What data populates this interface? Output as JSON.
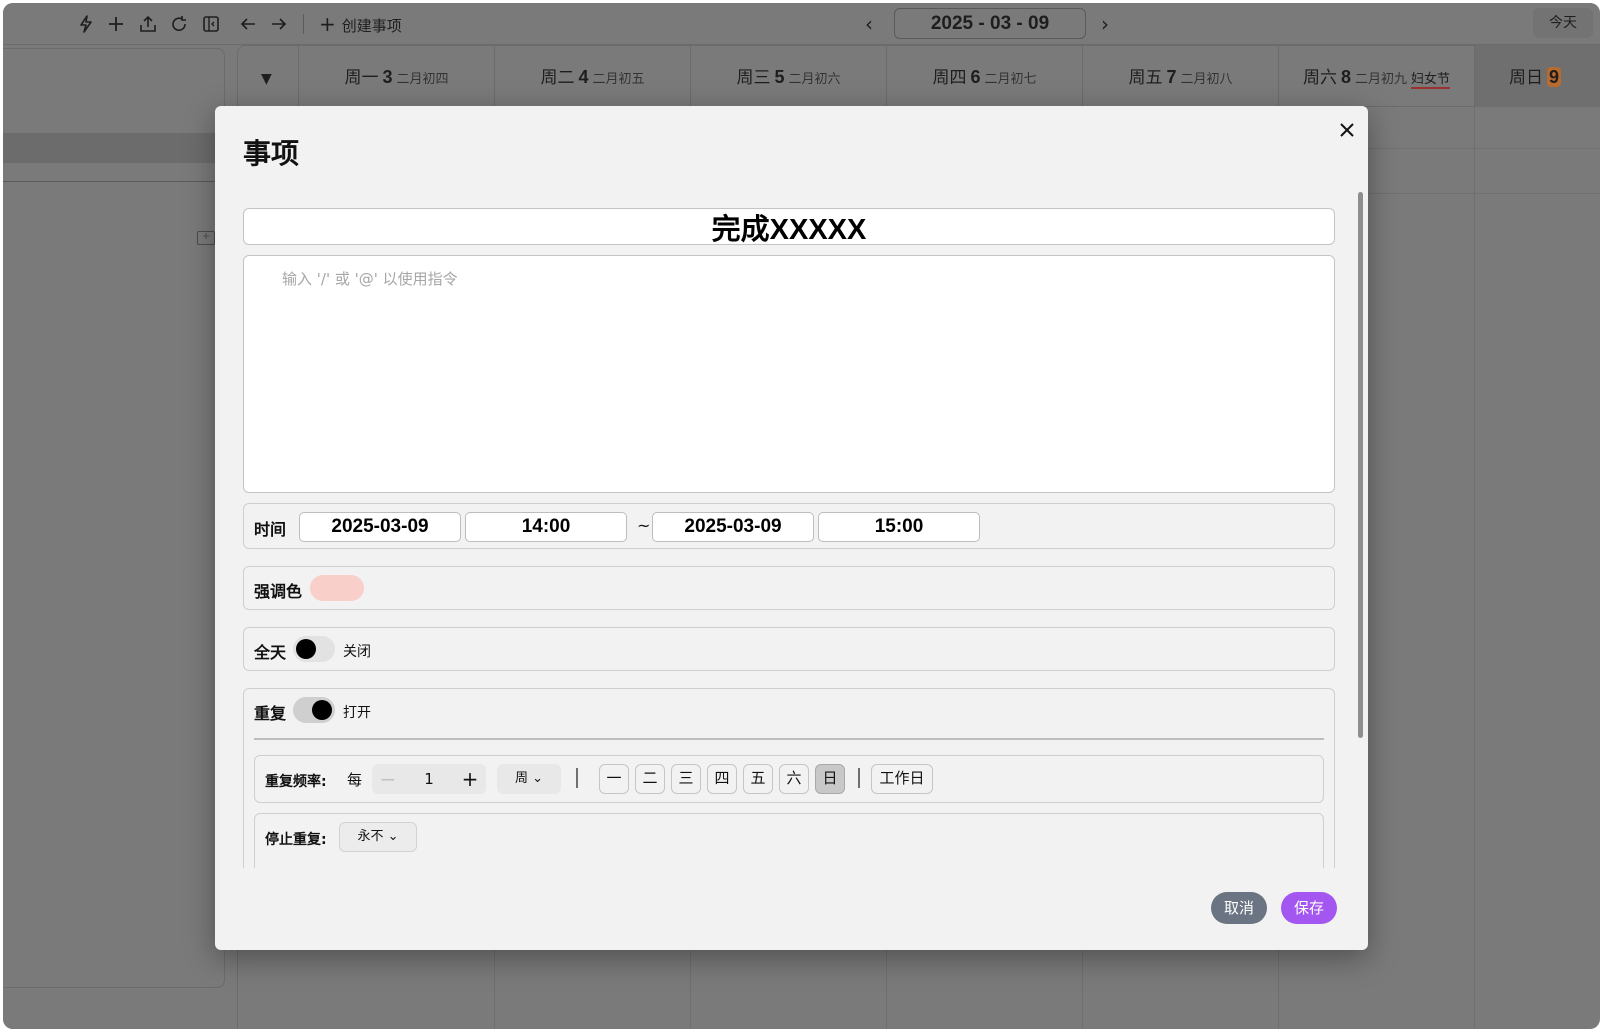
{
  "toolbar": {
    "icons": [
      "lightning-icon",
      "plus-icon",
      "upload-icon",
      "refresh-icon",
      "sidebar-toggle-icon",
      "back-arrow-icon",
      "forward-arrow-icon"
    ],
    "create_label": "创建事项",
    "date_display": "2025 - 03 - 09",
    "today_label": "今天"
  },
  "week": {
    "days": [
      {
        "weekday": "周一",
        "num": "3",
        "lunar": "二月初四"
      },
      {
        "weekday": "周二",
        "num": "4",
        "lunar": "二月初五"
      },
      {
        "weekday": "周三",
        "num": "5",
        "lunar": "二月初六"
      },
      {
        "weekday": "周四",
        "num": "6",
        "lunar": "二月初七"
      },
      {
        "weekday": "周五",
        "num": "7",
        "lunar": "二月初八"
      },
      {
        "weekday": "周六",
        "num": "8",
        "lunar": "二月初九",
        "festival": "妇女节"
      },
      {
        "weekday": "周日",
        "num": "9"
      }
    ]
  },
  "modal": {
    "title": "事项",
    "event_title": "完成XXXXX",
    "description_placeholder": "输入 '/' 或 '@' 以使用指令",
    "time": {
      "label": "时间",
      "start_date": "2025-03-09",
      "start_time": "14:00",
      "separator": "~",
      "end_date": "2025-03-09",
      "end_time": "15:00"
    },
    "accent": {
      "label": "强调色",
      "color": "#f9cfca"
    },
    "all_day": {
      "label": "全天",
      "state": "关闭"
    },
    "repeat": {
      "label": "重复",
      "state": "打开",
      "frequency_label": "重复频率:",
      "every": "每",
      "interval": "1",
      "unit": "周",
      "weekdays": [
        "一",
        "二",
        "三",
        "四",
        "五",
        "六",
        "日"
      ],
      "selected_weekday": "日",
      "workday_label": "工作日",
      "stop_label": "停止重复:",
      "stop_value": "永不"
    },
    "cancel_label": "取消",
    "save_label": "保存"
  },
  "colors": {
    "accent_purple": "#a356f0",
    "cancel_gray": "#6a7482",
    "sunday_badge": "#b96b2e"
  }
}
